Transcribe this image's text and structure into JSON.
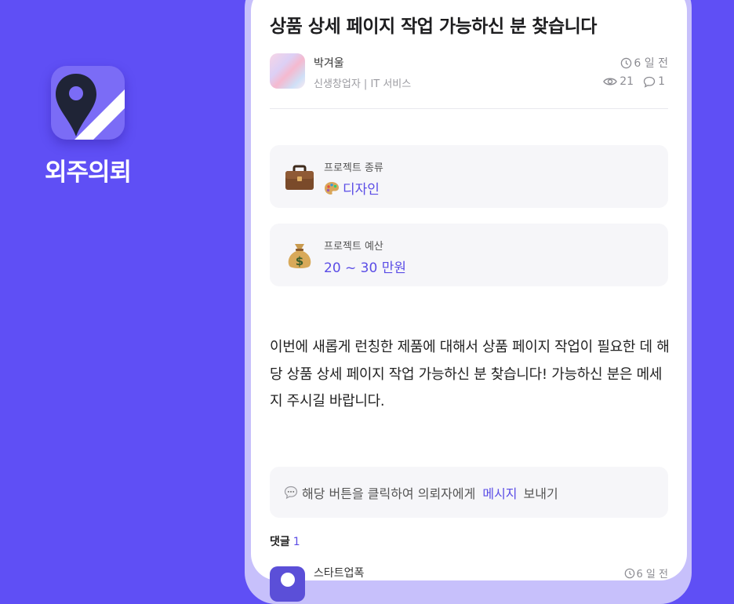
{
  "brand": {
    "name": "외주의뢰",
    "icon": "location-pin-icon"
  },
  "post": {
    "title": "상품 상세 페이지 작업 가능하신 분 찾습니다",
    "author": {
      "name": "박겨울",
      "meta": "신생창업자 | IT 서비스"
    },
    "time": "6 일 전",
    "views": "21",
    "comments": "1"
  },
  "project_type": {
    "label": "프로젝트 종류",
    "value": "디자인",
    "icon": "briefcase-icon",
    "value_icon": "palette-icon"
  },
  "project_budget": {
    "label": "프로젝트 예산",
    "value": "20 ~ 30 만원",
    "icon": "money-bag-icon"
  },
  "body": "이번에 새롭게 런칭한 제품에 대해서 상품 페이지 작업이 필요한 데 해당 상품 상세 페이지 작업 가능하신 분 찾습니다! 가능하신 분은 메세지 주시길 바랍니다.",
  "message_prompt": {
    "before": "해당 버튼을 클릭하여 의뢰자에게",
    "link": "메시지",
    "after": "보내기",
    "icon": "speech-bubble-icon"
  },
  "comments_section": {
    "label": "댓글",
    "count": "1",
    "first": {
      "author": "스타트업폭",
      "time": "6 일 전"
    }
  },
  "colors": {
    "accent": "#5b4de6",
    "background": "#5f4ff5",
    "frame": "#c7c0fb"
  }
}
